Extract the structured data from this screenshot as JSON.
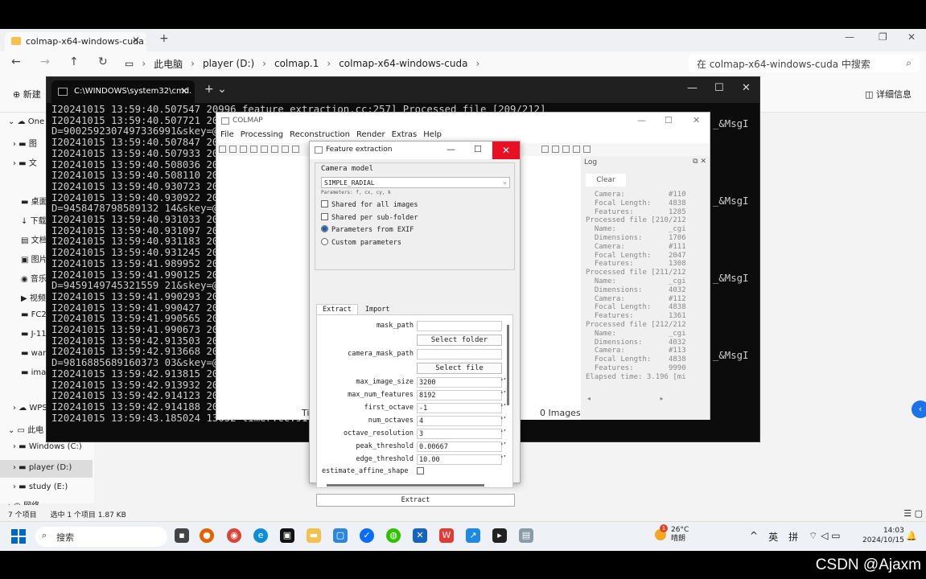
{
  "explorer": {
    "tab_title": "colmap-x64-windows-cuda",
    "breadcrumb": [
      "此电脑",
      "player (D:)",
      "colmap.1",
      "colmap-x64-windows-cuda"
    ],
    "search_placeholder": "在 colmap-x64-windows-cuda 中搜索",
    "new_label": "新建",
    "details_label": "详细信息",
    "sidebar_short": [
      "One",
      "图",
      "文",
      "桌面",
      "下载",
      "文档",
      "图片",
      "音乐",
      "视频",
      "FC2",
      "J-11",
      "war",
      "ima"
    ],
    "sidebar_drives": [
      "WPS",
      "此电",
      "Windows (C:)",
      "player (D:)",
      "study (E:)",
      "网络"
    ],
    "status": [
      "7 个项目",
      "选中 1 个项目 1.87 KB"
    ]
  },
  "cmd": {
    "title": "C:\\WINDOWS\\system32\\cmd.",
    "lines": [
      "I20241015 13:59:40.507547 20996 feature_extraction.cc:257] Processed file [209/212]",
      "I20241015 13:59:40.507721 209",
      "D=9002592307497336991&skey=@c",
      "I20241015 13:59:40.507847 209",
      "I20241015 13:59:40.507933 209",
      "I20241015 13:59:40.508036 209",
      "I20241015 13:59:40.508110 209",
      "I20241015 13:59:40.930723 209",
      "I20241015 13:59:40.930922 209",
      "D=9458478798589132 14&skey=@cr",
      "I20241015 13:59:40.931033 209",
      "I20241015 13:59:40.931097 209",
      "I20241015 13:59:40.931183 209",
      "I20241015 13:59:40.931245 209",
      "I20241015 13:59:41.989952 209",
      "I20241015 13:59:41.990125 209",
      "D=9459149745321559 21&skey=@cr",
      "I20241015 13:59:41.990293 209",
      "I20241015 13:59:41.990427 209",
      "I20241015 13:59:41.990565 209",
      "I20241015 13:59:41.990673 209",
      "I20241015 13:59:42.913503 209",
      "I20241015 13:59:42.913668 209",
      "D=9816885689160373 03&skey=@cr",
      "I20241015 13:59:42.913815 209",
      "I20241015 13:59:42.913932 209",
      "I20241015 13:59:42.914123 209",
      "I20241015 13:59:42.914188 209",
      "I20241015 13:59:43.185024 13652 timer.cc:91]"
    ],
    "right_text": [
      "_&MsgI",
      "_&MsgI",
      "_&MsgI",
      "_&MsgI"
    ]
  },
  "colmap": {
    "title": "COLMAP",
    "menu": [
      "File",
      "Processing",
      "Reconstruction",
      "Render",
      "Extras",
      "Help"
    ],
    "points_label": "0 Images - 0 Points",
    "timeline_label": "Ti",
    "log_title": "Log",
    "clear_label": "Clear",
    "log_lines": [
      "  Camera:          #110",
      "  Focal Length:    4838",
      "  Features:        1285",
      "Processed file [210/212",
      "  Name:            _cgi",
      "  Dimensions:      1706",
      "  Camera:          #111",
      "  Focal Length:    2047",
      "  Features:        1308",
      "Processed file [211/212",
      "  Name:            _cgi",
      "  Dimensions:      4032",
      "  Camera:          #112",
      "  Focal Length:    4838",
      "  Features:        1361",
      "Processed file [212/212",
      "  Name:            _cgi",
      "  Dimensions:      4032",
      "  Camera:          #113",
      "  Focal Length:    4838",
      "  Features:        9990",
      "Elapsed time: 3.196 [mi"
    ]
  },
  "feature": {
    "title": "Feature extraction",
    "camera_model_label": "Camera model",
    "camera_model_value": "SIMPLE_RADIAL",
    "params_hint": "Parameters: f, cx, cy, k",
    "options": [
      "Shared for all images",
      "Shared per sub-folder",
      "Parameters from EXIF",
      "Custom parameters"
    ],
    "tabs": [
      "Extract",
      "Import"
    ],
    "mask_path_label": "mask_path",
    "select_folder": "Select folder",
    "camera_mask_path_label": "camera_mask_path",
    "select_file": "Select file",
    "params": [
      {
        "label": "max_image_size",
        "value": "3200"
      },
      {
        "label": "max_num_features",
        "value": "8192"
      },
      {
        "label": "first_octave",
        "value": "-1"
      },
      {
        "label": "num_octaves",
        "value": "4"
      },
      {
        "label": "octave_resolution",
        "value": "3"
      },
      {
        "label": "peak_threshold",
        "value": "0.00667"
      },
      {
        "label": "edge_threshold",
        "value": "10.00"
      }
    ],
    "affine_label": "estimate_affine_shape",
    "extract_button": "Extract"
  },
  "taskbar": {
    "search": "搜索",
    "temp": "26°C",
    "weather": "晴朗",
    "badge": "1",
    "ime1": "英",
    "ime2": "拼",
    "time": "14:03",
    "date": "2024/10/15"
  },
  "watermark": "CSDN @Ajaxm"
}
